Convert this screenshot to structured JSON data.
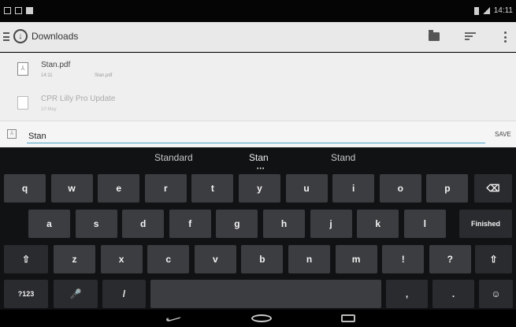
{
  "status_bar": {
    "time": "14:11"
  },
  "app_bar": {
    "title": "Downloads",
    "icons": [
      "menu-icon",
      "download-icon",
      "folder-icon",
      "sort-icon",
      "overflow-menu-icon"
    ]
  },
  "files": [
    {
      "name": "Stan.pdf",
      "meta": "14:11",
      "extra": "Stan.pdf",
      "dimmed": false
    },
    {
      "name": "CPR Lilly Pro Update",
      "meta": "10 May",
      "extra": "",
      "dimmed": true
    }
  ],
  "save_bar": {
    "filename_value": "Stan",
    "save_label": "SAVE"
  },
  "keyboard": {
    "suggestions": [
      "Standard",
      "Stan",
      "Stand"
    ],
    "suggestion_dots": "•••",
    "row1": [
      "q",
      "w",
      "e",
      "r",
      "t",
      "y",
      "u",
      "i",
      "o",
      "p"
    ],
    "row2": [
      "a",
      "s",
      "d",
      "f",
      "g",
      "h",
      "j",
      "k",
      "l"
    ],
    "row3": [
      "z",
      "x",
      "c",
      "v",
      "b",
      "n",
      "m",
      "!",
      "?"
    ],
    "finished_label": "Finished",
    "symbols_label": "?123",
    "slash": "/",
    "comma": ",",
    "period": ".",
    "shift_glyph": "⇧",
    "backspace_glyph": "⌫",
    "mic_glyph": "🎤",
    "emoji_glyph": "☺"
  },
  "colors": {
    "accent": "#4aa3c9",
    "key_bg": "#3c3d40",
    "keyboard_bg": "#111214"
  }
}
